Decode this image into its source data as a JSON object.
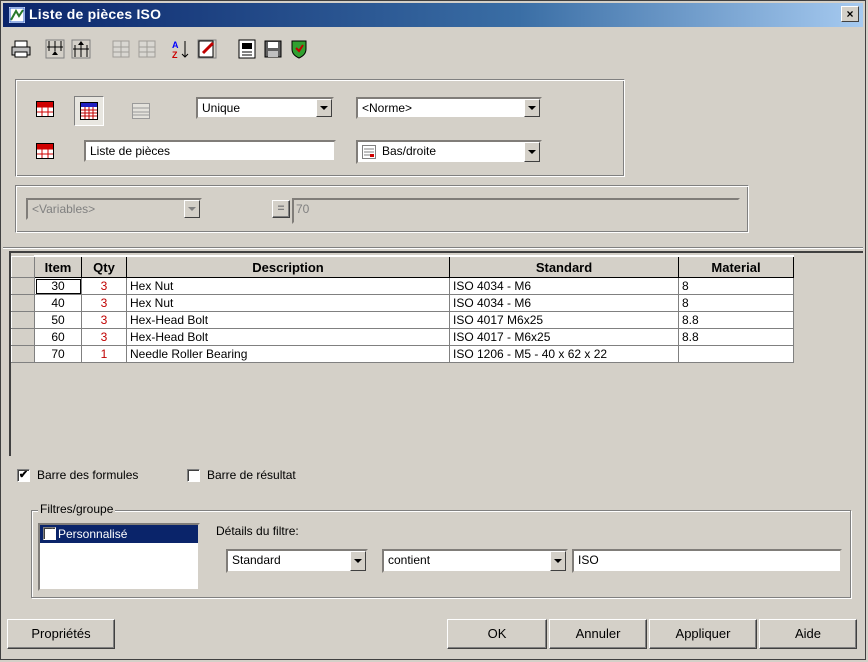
{
  "window": {
    "title": "Liste de pièces ISO",
    "close_label": "×"
  },
  "toolbar": {
    "icons": [
      "printer-icon",
      "sort-down-icon",
      "sort-up-icon",
      "expand-icon",
      "collapse-icon",
      "sort-az-icon",
      "edit-icon",
      "table-icon",
      "save-icon",
      "shield-icon"
    ]
  },
  "settings": {
    "mode_value": "Unique",
    "norm_value": "<Norme>",
    "title_value": "Liste de pièces",
    "position_value": "Bas/droite"
  },
  "formula": {
    "variables_value": "<Variables>",
    "equals_label": "=",
    "expression_value": "70"
  },
  "table": {
    "columns": [
      "Item",
      "Qty",
      "Description",
      "Standard",
      "Material"
    ],
    "rows": [
      {
        "item": "30",
        "qty": "3",
        "description": "Hex Nut",
        "standard": "ISO 4034 - M6",
        "material": "8"
      },
      {
        "item": "40",
        "qty": "3",
        "description": "Hex Nut",
        "standard": "ISO 4034 - M6",
        "material": "8"
      },
      {
        "item": "50",
        "qty": "3",
        "description": "Hex-Head Bolt",
        "standard": "ISO 4017 M6x25",
        "material": "8.8"
      },
      {
        "item": "60",
        "qty": "3",
        "description": "Hex-Head Bolt",
        "standard": "ISO 4017 - M6x25",
        "material": "8.8"
      },
      {
        "item": "70",
        "qty": "1",
        "description": "Needle Roller Bearing",
        "standard": "ISO 1206 - M5  - 40 x 62 x 22",
        "material": ""
      }
    ]
  },
  "options": {
    "formula_bar_label": "Barre des formules",
    "formula_bar_checked": true,
    "result_bar_label": "Barre de résultat",
    "result_bar_checked": false
  },
  "filters": {
    "legend": "Filtres/groupe",
    "groups": [
      {
        "label": "Personnalisé",
        "checked": true,
        "selected": true
      }
    ],
    "details_label": "Détails du filtre:",
    "field_value": "Standard",
    "operator_value": "contient",
    "filter_value": "ISO"
  },
  "buttons": {
    "properties": "Propriétés",
    "ok": "OK",
    "cancel": "Annuler",
    "apply": "Appliquer",
    "help": "Aide"
  },
  "colors": {
    "title_bar": "#0a246a",
    "qty_text": "#c00000",
    "selection": "#0a246a"
  }
}
